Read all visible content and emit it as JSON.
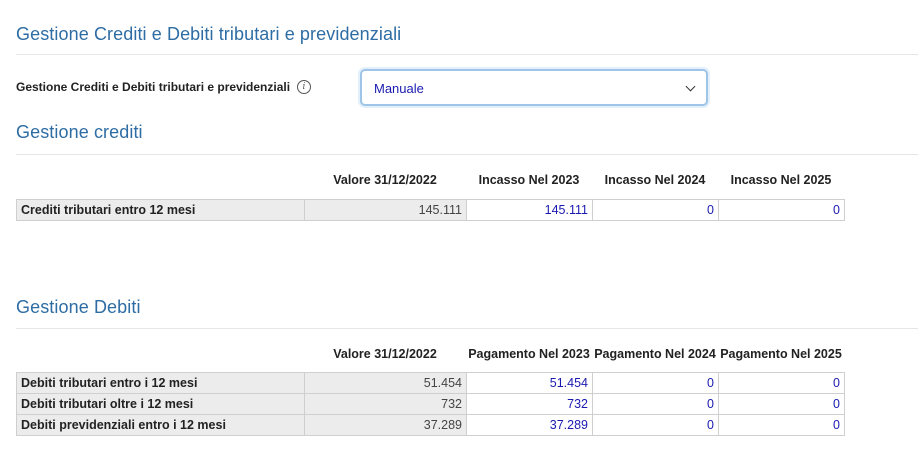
{
  "main": {
    "title": "Gestione Crediti e Debiti tributari e previdenziali",
    "field_label": "Gestione Crediti e Debiti tributari e previdenziali",
    "info_glyph": "i",
    "select_value": "Manuale"
  },
  "crediti": {
    "title": "Gestione crediti",
    "headers": [
      "Valore 31/12/2022",
      "Incasso Nel 2023",
      "Incasso Nel 2024",
      "Incasso Nel 2025"
    ],
    "rows": [
      {
        "label": "Crediti tributari entro 12 mesi",
        "valore": "145.111",
        "y2023": "145.111",
        "y2024": "0",
        "y2025": "0"
      }
    ]
  },
  "debiti": {
    "title": "Gestione Debiti",
    "headers": [
      "Valore 31/12/2022",
      "Pagamento Nel 2023",
      "Pagamento Nel 2024",
      "Pagamento Nel 2025"
    ],
    "rows": [
      {
        "label": "Debiti tributari entro i 12 mesi",
        "valore": "51.454",
        "y2023": "51.454",
        "y2024": "0",
        "y2025": "0"
      },
      {
        "label": "Debiti tributari oltre i 12 mesi",
        "valore": "732",
        "y2023": "732",
        "y2024": "0",
        "y2025": "0"
      },
      {
        "label": "Debiti previdenziali entro i 12 mesi",
        "valore": "37.289",
        "y2023": "37.289",
        "y2024": "0",
        "y2025": "0"
      }
    ]
  }
}
